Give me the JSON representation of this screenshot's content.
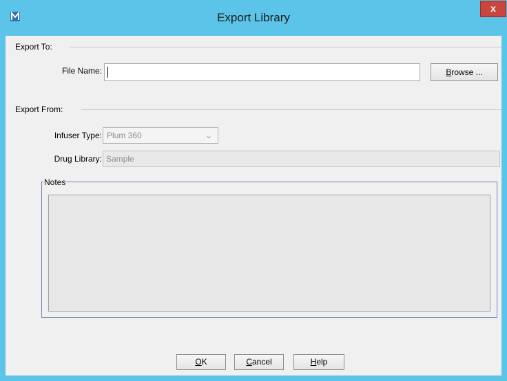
{
  "window": {
    "title": "Export Library",
    "close_label": "x"
  },
  "export_to": {
    "section_label": "Export To:",
    "file_name_label": "File Name:",
    "file_name_value": "",
    "browse_label_prefix": "B",
    "browse_label_rest": "rowse ..."
  },
  "export_from": {
    "section_label": "Export From:",
    "infuser_type_label": "Infuser Type:",
    "infuser_type_value": "Plum 360",
    "drug_library_label": "Drug Library:",
    "drug_library_value": "Sample",
    "notes_label": "Notes",
    "notes_value": ""
  },
  "buttons": {
    "ok_mnemonic": "O",
    "ok_rest": "K",
    "cancel_mnemonic": "C",
    "cancel_rest": "ancel",
    "help_mnemonic": "H",
    "help_rest": "elp"
  },
  "colors": {
    "title_bar": "#5bc4e8",
    "close_button": "#c7473e",
    "notes_border": "#6d7fb5"
  }
}
